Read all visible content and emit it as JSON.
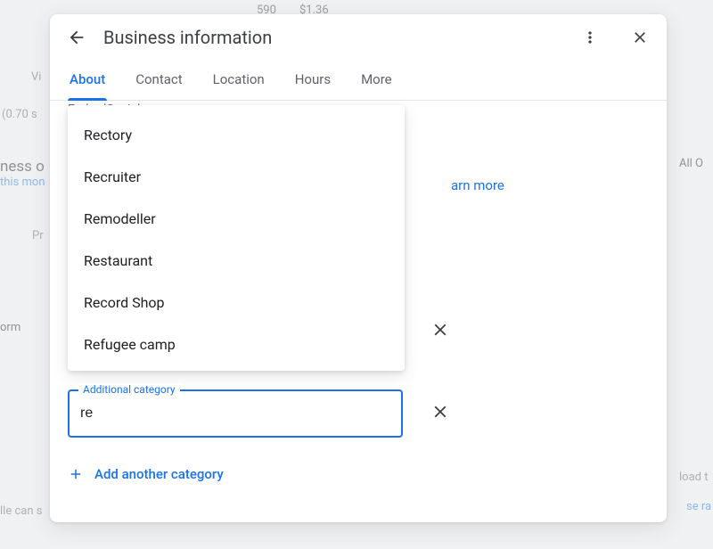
{
  "bg": {
    "t1": "590",
    "t2": "$1.36",
    "vi": "Vi",
    "secs": "(0.70 s",
    "ness": "ness o",
    "this_mon": "this mon",
    "pro": "Pr",
    "orm": "orm",
    "all_or": "All O",
    "load": "load t",
    "se": "se ra",
    "lle": "lle can s"
  },
  "header": {
    "title": "Business information"
  },
  "tabs": {
    "items": [
      "About",
      "Contact",
      "Location",
      "Hours",
      "More"
    ],
    "activeIndex": 0
  },
  "body": {
    "peek_business": "EmbedSocial",
    "learn_more": "arn more"
  },
  "dropdown": {
    "options": [
      "Rectory",
      "Recruiter",
      "Remodeller",
      "Restaurant",
      "Record Shop",
      "Refugee camp"
    ]
  },
  "field": {
    "label": "Additional category",
    "value": "re"
  },
  "add_link": "Add another category"
}
